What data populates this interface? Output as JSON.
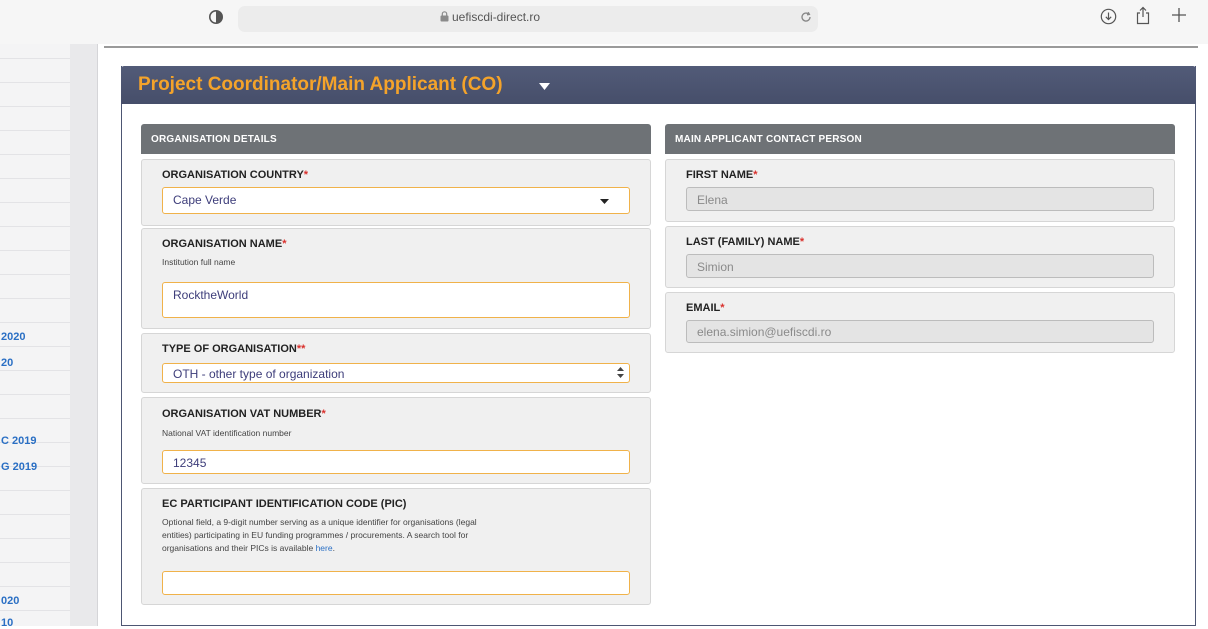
{
  "browser": {
    "url": "uefiscdi-direct.ro"
  },
  "sidebar": {
    "links": [
      "2020",
      "20",
      "C 2019",
      "G 2019",
      "020",
      "10"
    ]
  },
  "panel": {
    "title": "Project Coordinator/Main Applicant (CO)"
  },
  "organisation": {
    "section_title": "ORGANISATION DETAILS",
    "country": {
      "label": "ORGANISATION COUNTRY",
      "required": "*",
      "value": "Cape Verde"
    },
    "name": {
      "label": "ORGANISATION NAME",
      "required": "*",
      "help": "Institution full name",
      "value": "RocktheWorld"
    },
    "type": {
      "label": "TYPE OF ORGANISATION",
      "required": "**",
      "value": "OTH - other type of organization"
    },
    "vat": {
      "label": "ORGANISATION VAT NUMBER",
      "required": "*",
      "help": "National VAT identification number",
      "value": "12345"
    },
    "pic": {
      "label": "EC PARTICIPANT IDENTIFICATION CODE (PIC)",
      "help_line1": "Optional field, a 9-digit number serving as a unique identifier for organisations (legal",
      "help_line2": "entities) participating in EU funding programmes / procurements. A search tool for",
      "help_line3": "organisations and their PICs is available",
      "help_link": "here",
      "help_end": ".",
      "value": ""
    }
  },
  "contact": {
    "section_title": "MAIN APPLICANT CONTACT PERSON",
    "first_name": {
      "label": "FIRST NAME",
      "required": "*",
      "value": "Elena"
    },
    "last_name": {
      "label": "LAST (FAMILY) NAME",
      "required": "*",
      "value": "Simion"
    },
    "email": {
      "label": "EMAIL",
      "required": "*",
      "value": "elena.simion@uefiscdi.ro"
    }
  },
  "colors": {
    "accent_orange": "#f4a32a",
    "header_navy": "#4b536f",
    "section_gray": "#6e7276",
    "required_red": "#d9302c",
    "link_blue": "#2a6fc4"
  },
  "icons": {
    "shield": "shield-icon",
    "lock": "lock-icon",
    "reload": "reload-icon",
    "download": "download-icon",
    "share": "share-icon",
    "new_tab": "plus-icon",
    "caret": "caret-down-icon",
    "select_arrow": "dropdown-arrow-icon",
    "select_updown": "select-updown-icon"
  }
}
